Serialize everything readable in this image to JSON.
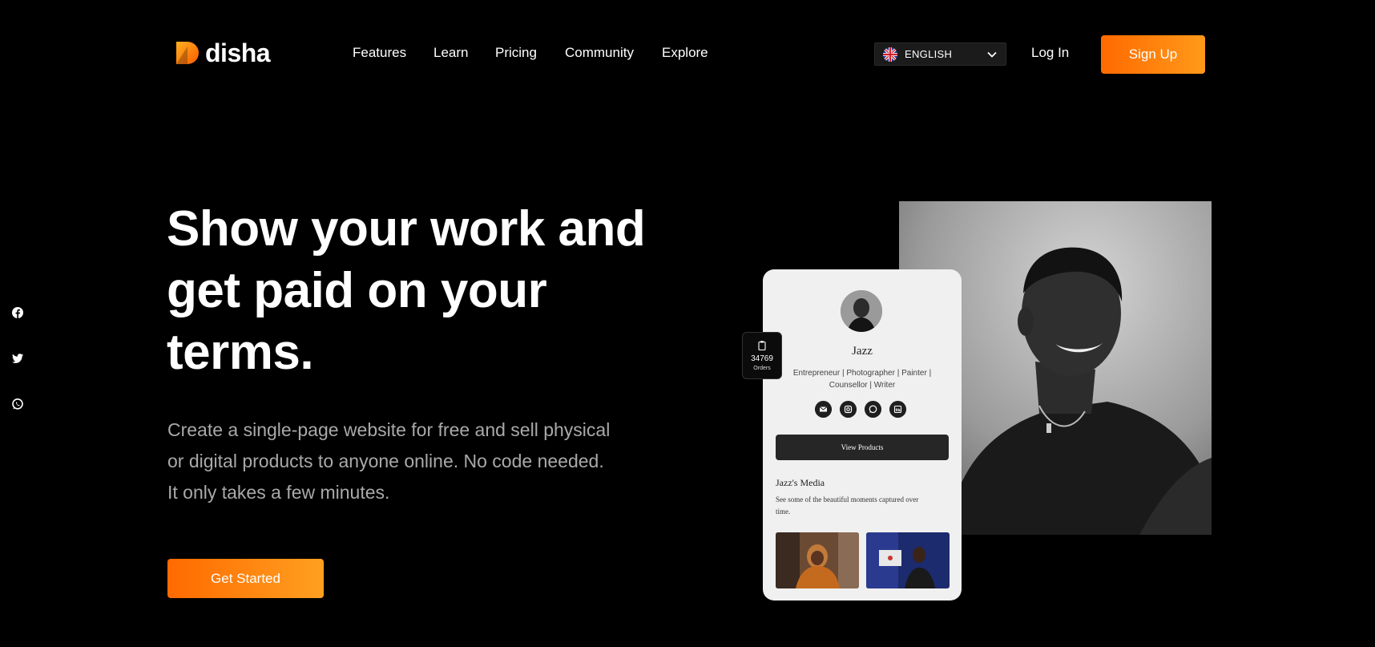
{
  "header": {
    "logo_text": "disha",
    "nav": [
      "Features",
      "Learn",
      "Pricing",
      "Community",
      "Explore"
    ],
    "language": "ENGLISH",
    "login_label": "Log In",
    "signup_label": "Sign Up"
  },
  "social_side": [
    "facebook-icon",
    "twitter-icon",
    "whatsapp-icon"
  ],
  "hero": {
    "headline_lines": [
      "Show your work and",
      "get paid on your",
      "terms."
    ],
    "sub_lines": [
      "Create a single-page website for free and sell physical",
      "or digital products to anyone online. No code needed.",
      "It only takes a few minutes."
    ],
    "cta_label": "Get Started"
  },
  "card": {
    "name": "Jazz",
    "roles_lines": [
      "Entrepreneur | Photographer | Painter |",
      "Counsellor | Writer"
    ],
    "icons": [
      "email-icon",
      "instagram-icon",
      "whatsapp-icon",
      "linkedin-icon"
    ],
    "view_products_label": "View Products",
    "media_title": "Jazz's Media",
    "media_desc_lines": [
      "See some of the beautiful moments captured over",
      "time."
    ]
  },
  "orders_badge": {
    "count": "34769",
    "label": "Orders"
  },
  "colors": {
    "accent_start": "#ff6a00",
    "accent_end": "#ffa020",
    "background": "#000000"
  }
}
